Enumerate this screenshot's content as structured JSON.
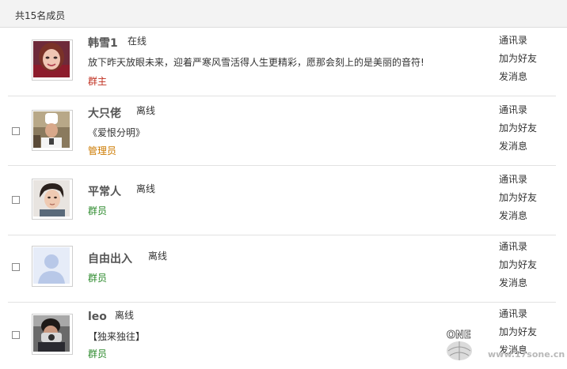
{
  "header": {
    "member_count_text": "共15名成员"
  },
  "members": [
    {
      "name": "韩雪1",
      "status": "在线",
      "motto": "放下昨天放眼未来，迎着严寒风雪活得人生更精彩，愿那会刻上的是美丽的音符!",
      "role": "群主",
      "has_checkbox": false,
      "actions": {
        "contacts": "通讯录",
        "add_friend": "加为好友",
        "message": "发消息"
      }
    },
    {
      "name": "大只佬",
      "status": "离线",
      "motto": "《爱恨分明》",
      "role": "管理员",
      "has_checkbox": true,
      "actions": {
        "contacts": "通讯录",
        "add_friend": "加为好友",
        "message": "发消息"
      }
    },
    {
      "name": "平常人",
      "status": "离线",
      "motto": "",
      "role": "群员",
      "has_checkbox": true,
      "actions": {
        "contacts": "通讯录",
        "add_friend": "加为好友",
        "message": "发消息"
      }
    },
    {
      "name": "自由出入",
      "status": "离线",
      "motto": "",
      "role": "群员",
      "has_checkbox": true,
      "actions": {
        "contacts": "通讯录",
        "add_friend": "加为好友",
        "message": "发消息"
      }
    },
    {
      "name": "leo",
      "status": "离线",
      "motto": "【独来独往】",
      "role": "群员",
      "has_checkbox": true,
      "actions": {
        "contacts": "通讯录",
        "add_friend": "加为好友",
        "message": "发消息"
      }
    }
  ],
  "watermark": {
    "logo": "ONE",
    "url": "www.17sone.cn"
  }
}
